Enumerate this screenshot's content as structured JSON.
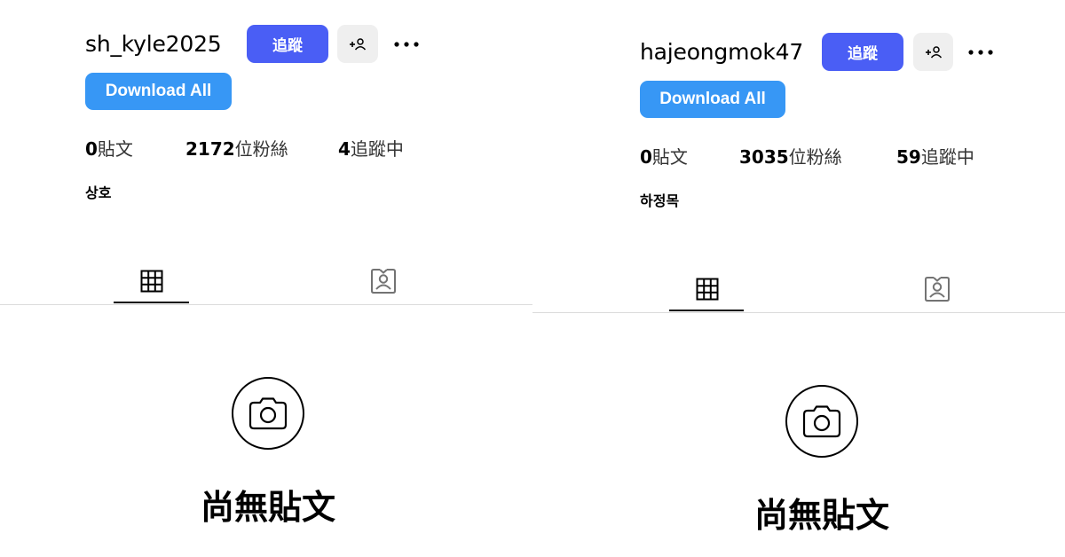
{
  "profiles": [
    {
      "username": "sh_kyle2025",
      "follow_label": "追蹤",
      "download_label": "Download All",
      "stats": [
        {
          "num": "0",
          "label": "貼文"
        },
        {
          "num": "2172",
          "label": "位粉絲"
        },
        {
          "num": "4",
          "label": "追蹤中"
        }
      ],
      "full_name": "상호",
      "empty_state": "尚無貼文"
    },
    {
      "username": "hajeongmok47",
      "follow_label": "追蹤",
      "download_label": "Download All",
      "stats": [
        {
          "num": "0",
          "label": "貼文"
        },
        {
          "num": "3035",
          "label": "位粉絲"
        },
        {
          "num": "59",
          "label": "追蹤中"
        }
      ],
      "full_name": "하정목",
      "empty_state": "尚無貼文"
    }
  ],
  "icons": {
    "add_user": "add-user-icon",
    "more": "more-horizontal-icon",
    "grid_tab": "grid-icon",
    "tagged_tab": "tagged-person-icon",
    "camera": "camera-icon"
  },
  "colors": {
    "follow_button": "#4a5ef5",
    "download_button": "#3797f5",
    "secondary_button": "#efefef",
    "divider": "#dbdbdb"
  }
}
